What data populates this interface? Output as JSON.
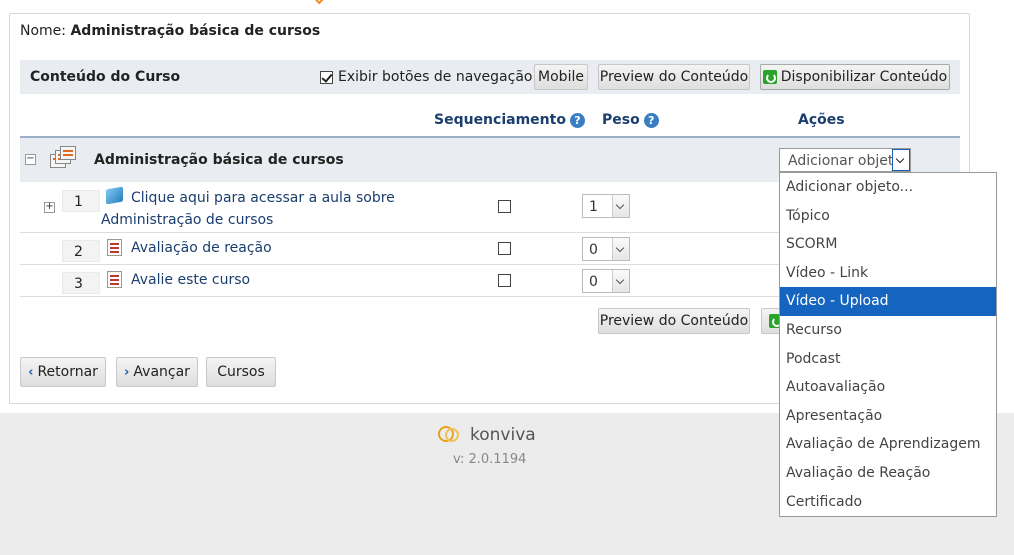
{
  "name_bar": {
    "label": "Nome:",
    "value": "Administração básica de cursos"
  },
  "toolbar": {
    "title": "Conteúdo do Curso",
    "nav_checkbox_label": "Exibir botões de navegação",
    "nav_checkbox_checked": true,
    "mobile_button": "Mobile",
    "preview_button": "Preview do Conteúdo",
    "publish_button": "Disponibilizar Conteúdo"
  },
  "table": {
    "headers": {
      "sequencing": "Sequenciamento",
      "weight": "Peso",
      "actions": "Ações"
    },
    "help_icon_glyph": "?",
    "course": {
      "title": "Administração básica de cursos",
      "action_select_value": "Adicionar objeto..."
    },
    "rows": [
      {
        "number": "1",
        "title_line1": "Clique aqui para acessar a aula sobre",
        "title_line2": "Administração de cursos",
        "sequencing": false,
        "weight": "1",
        "icon": "cube-icon"
      },
      {
        "number": "2",
        "title": "Avaliação de reação",
        "sequencing": false,
        "weight": "0",
        "icon": "evaluation-icon"
      },
      {
        "number": "3",
        "title": "Avalie este curso",
        "sequencing": false,
        "weight": "0",
        "icon": "evaluation-icon"
      }
    ]
  },
  "bottom_preview_button": "Preview do Conteúdo",
  "nav_buttons": {
    "back": "Retornar",
    "next": "Avançar",
    "courses": "Cursos"
  },
  "dropdown": {
    "options": [
      "Adicionar objeto...",
      "Tópico",
      "SCORM",
      "Vídeo - Link",
      "Vídeo - Upload",
      "Recurso",
      "Podcast",
      "Autoavaliação",
      "Apresentação",
      "Avaliação de Aprendizagem",
      "Avaliação de Reação",
      "Certificado"
    ],
    "highlighted": "Vídeo - Upload"
  },
  "footer": {
    "brand": "konviva",
    "version": "v: 2.0.1194"
  },
  "colors": {
    "accent": "#1565c0",
    "header_text": "#1a3e6e",
    "publish_icon": "#29a329",
    "logo": "#e8a21e"
  }
}
